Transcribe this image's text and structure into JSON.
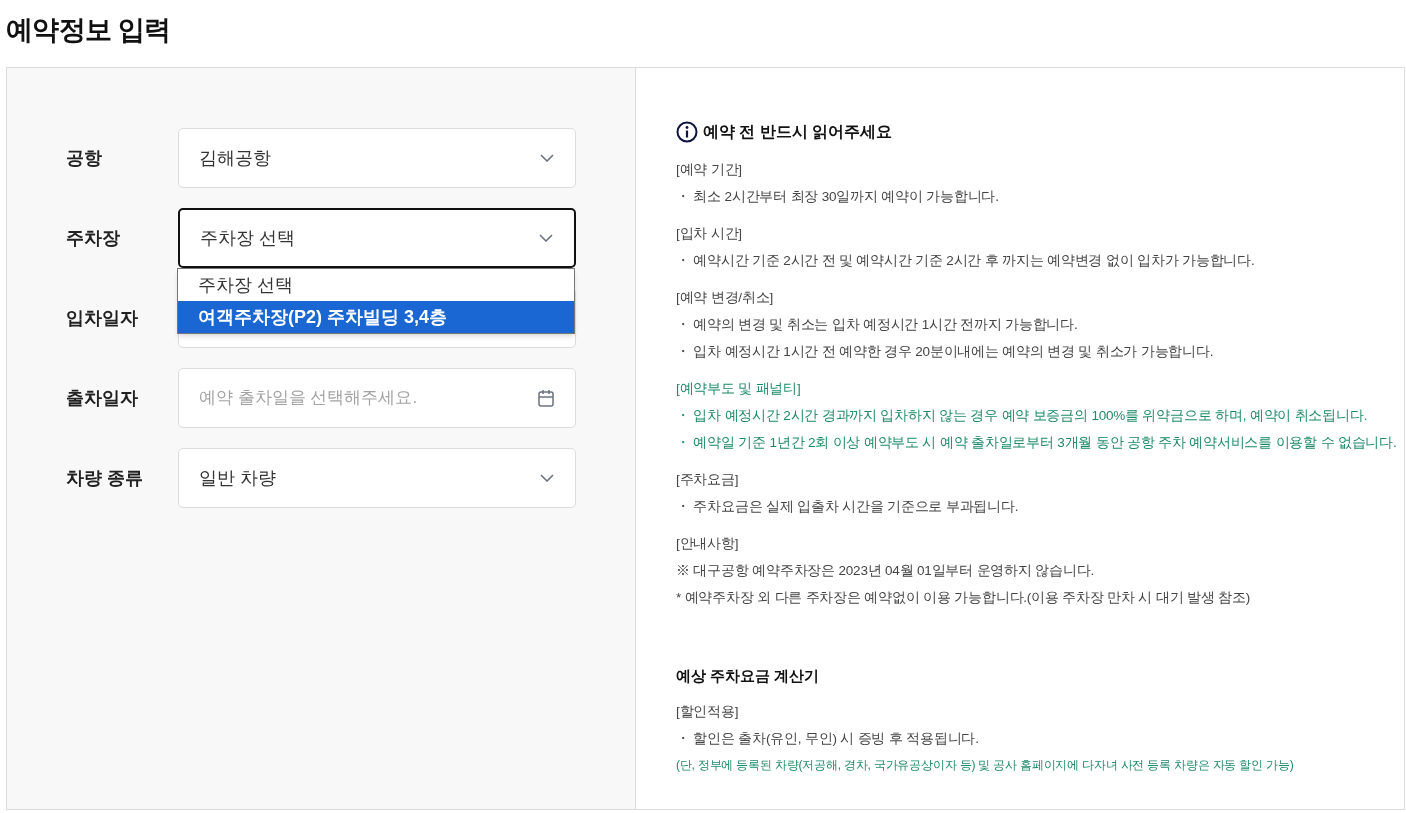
{
  "page_title": "예약정보 입력",
  "form": {
    "fields": [
      {
        "label": "공항",
        "kind": "select",
        "value": "김해공항",
        "focused": false
      },
      {
        "label": "주차장",
        "kind": "select",
        "value": "주차장 선택",
        "focused": true
      },
      {
        "label": "입차일자",
        "kind": "date",
        "focused": false
      },
      {
        "label": "출차일자",
        "kind": "date",
        "placeholder": "예약 출차일을 선택해주세요.",
        "focused": false
      },
      {
        "label": "차량 종류",
        "kind": "select",
        "value": "일반 차량",
        "focused": false
      }
    ],
    "dropdown": {
      "options": [
        {
          "label": "주차장 선택",
          "selected": false
        },
        {
          "label": "여객주차장(P2) 주차빌딩 3,4층",
          "selected": true
        }
      ]
    }
  },
  "notice": {
    "heading": "예약 전 반드시 읽어주세요",
    "sections": [
      {
        "title": "[예약 기간]",
        "kind": "plain",
        "lines": [
          {
            "text": "・ 최소 2시간부터 최장 30일까지 예약이 가능합니다.",
            "kind": "plain"
          }
        ]
      },
      {
        "title": "[입차 시간]",
        "kind": "plain",
        "lines": [
          {
            "text": "・ 예약시간 기준 2시간 전 및 예약시간 기준 2시간 후 까지는 예약변경 없이 입차가 가능합니다.",
            "kind": "plain"
          }
        ]
      },
      {
        "title": "[예약 변경/취소]",
        "kind": "plain",
        "lines": [
          {
            "text": "・ 예약의 변경 및 취소는 입차 예정시간 1시간 전까지 가능합니다.",
            "kind": "plain"
          },
          {
            "text": "・ 입차 예정시간 1시간 전 예약한 경우 20분이내에는 예약의 변경 및 취소가 가능합니다.",
            "kind": "plain"
          }
        ]
      },
      {
        "title": "[예약부도 및 패널티]",
        "kind": "penalty",
        "lines": [
          {
            "text": "・ 입차 예정시간 2시간 경과까지 입차하지 않는 경우 예약 보증금의 100%를 위약금으로 하며, 예약이 취소됩니다.",
            "kind": "penalty"
          },
          {
            "text": "・ 예약일 기준 1년간 2회 이상 예약부도 시 예약 출차일로부터 3개월 동안 공항 주차 예약서비스를 이용할 수 없습니다.",
            "kind": "penalty"
          }
        ]
      },
      {
        "title": "[주차요금]",
        "kind": "plain",
        "lines": [
          {
            "text": "・ 주차요금은 실제 입출차 시간을 기준으로 부과됩니다.",
            "kind": "plain"
          }
        ]
      },
      {
        "title": "[안내사항]",
        "kind": "plain",
        "lines": [
          {
            "text": "※ 대구공항 예약주차장은 2023년 04월 01일부터 운영하지 않습니다.",
            "kind": "plain"
          },
          {
            "text": "* 예약주차장 외 다른 주차장은 예약없이 이용 가능합니다.(이용 주차장 만차 시 대기 발생 참조)",
            "kind": "plain"
          }
        ]
      }
    ]
  },
  "calculator": {
    "heading": "예상 주차요금 계산기",
    "sections": [
      {
        "title": "[할인적용]",
        "kind": "plain",
        "lines": [
          {
            "text": "・ 할인은 출차(유인, 무인) 시 증빙 후 적용됩니다.",
            "kind": "plain"
          },
          {
            "text": "(단, 정부에 등록된 차량(저공해, 경차, 국가유공상이자 등) 및 공사 홈페이지에 다자녀 사전 등록 차량은 자동 할인 가능)",
            "kind": "footnote"
          }
        ]
      }
    ]
  }
}
